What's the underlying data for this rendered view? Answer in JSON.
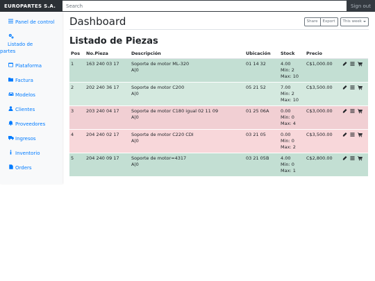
{
  "navbar": {
    "brand": "EUROPARTES S.A.",
    "search_placeholder": "Search",
    "signout_label": "Sign out"
  },
  "sidebar": {
    "items": [
      {
        "label": "Panel de control",
        "icon": "list-icon"
      },
      {
        "label": "Listado de",
        "label2": "partes",
        "icon": "cogs-icon"
      },
      {
        "label": "Plataforma",
        "icon": "window-icon"
      },
      {
        "label": "Factura",
        "icon": "folder-icon"
      },
      {
        "label": "Modelos",
        "icon": "car-icon"
      },
      {
        "label": "Clientes",
        "icon": "user-icon"
      },
      {
        "label": "Proveedores",
        "icon": "bell-icon"
      },
      {
        "label": "Ingresos",
        "icon": "truck-icon"
      },
      {
        "label": "Inventorio",
        "icon": "info-icon"
      },
      {
        "label": "Orders",
        "icon": "file-icon"
      }
    ]
  },
  "header": {
    "title": "Dashboard",
    "share_label": "Share",
    "export_label": "Export",
    "period_label": "This week"
  },
  "section_title": "Listado de Piezas",
  "table": {
    "columns": [
      "Pos",
      "No.Pieza",
      "Descripción",
      "Ubicación",
      "Stock",
      "Precio"
    ],
    "rows": [
      {
        "pos": "1",
        "no": "163 240 03 17",
        "desc": "Soporte de motor ML-320",
        "desc2": "A|0",
        "ubi": "01 14 32",
        "stock": "4.00",
        "min": "Min: 2",
        "max": "Max: 10",
        "price": "C$1,000.00",
        "status": "green"
      },
      {
        "pos": "2",
        "no": "202 240 36 17",
        "desc": "Soporte de motor C200",
        "desc2": "A|0",
        "ubi": "05 21 52",
        "stock": "7.00",
        "min": "Min: 2",
        "max": "Max: 10",
        "price": "C$3,500.00",
        "status": "green"
      },
      {
        "pos": "3",
        "no": "203 240 04 17",
        "desc": "Soporte de motor C180 igual 02 11 09",
        "desc2": "A|0",
        "ubi": "01 25 06A",
        "stock": "0.00",
        "min": "Min: 0",
        "max": "Max: 4",
        "price": "C$3,000.00",
        "status": "red"
      },
      {
        "pos": "4",
        "no": "204 240 02 17",
        "desc": "Soporte de motor C220 CDI",
        "desc2": "A|0",
        "ubi": "03 21 05",
        "stock": "0.00",
        "min": "Min: 0",
        "max": "Max: 2",
        "price": "C$3,500.00",
        "status": "red"
      },
      {
        "pos": "5",
        "no": "204 240 09 17",
        "desc": "Soporte de motor=4317",
        "desc2": "A|0",
        "ubi": "03 21 05B",
        "stock": "4.00",
        "min": "Min: 0",
        "max": "Max: 1",
        "price": "C$2,800.00",
        "status": "green"
      }
    ]
  },
  "colors": {
    "navbar": "#343a40",
    "link": "#007bff",
    "row_ok": "#c3dfd3",
    "row_out": "#f1cfd3"
  }
}
